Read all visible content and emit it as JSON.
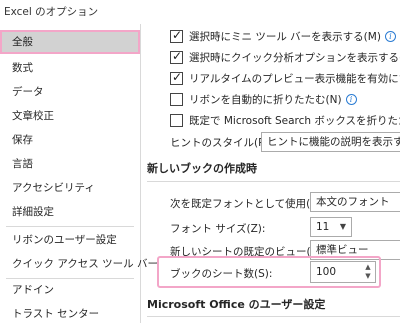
{
  "window": {
    "title": "Excel のオプション"
  },
  "sidebar": {
    "items": [
      {
        "label": "全般"
      },
      {
        "label": "数式"
      },
      {
        "label": "データ"
      },
      {
        "label": "文章校正"
      },
      {
        "label": "保存"
      },
      {
        "label": "言語"
      },
      {
        "label": "アクセシビリティ"
      },
      {
        "label": "詳細設定"
      },
      {
        "label": "リボンのユーザー設定"
      },
      {
        "label": "クイック アクセス ツール バー"
      },
      {
        "label": "アドイン"
      },
      {
        "label": "トラスト センター"
      }
    ],
    "selected": "全般"
  },
  "ui_options": {
    "mini_toolbar": {
      "label": "選択時にミニ ツール バーを表示する(M)",
      "checked": true
    },
    "quick_analysis": {
      "label": "選択時にクイック分析オプションを表示する(Q)",
      "checked": true
    },
    "live_preview": {
      "label": "リアルタイムのプレビュー表示機能を有効にする(L)",
      "checked": true
    },
    "collapse_ribbon": {
      "label": "リボンを自動的に折りたたむ(N)",
      "checked": false
    },
    "collapse_search": {
      "label": "既定で Microsoft Search ボックスを折りたたむ(B)",
      "checked": false
    },
    "tooltip_style": {
      "label": "ヒントのスタイル(R):",
      "value": "ヒントに機能の説明を表示する"
    }
  },
  "new_workbook": {
    "section_title": "新しいブックの作成時",
    "default_font": {
      "label": "次を既定フォントとして使用(N):",
      "value": "本文のフォント"
    },
    "font_size": {
      "label": "フォント サイズ(Z):",
      "value": "11"
    },
    "default_view": {
      "label": "新しいシートの既定のビュー(V):",
      "value": "標準ビュー"
    },
    "sheet_count": {
      "label": "ブックのシート数(S):",
      "value": "100"
    }
  },
  "user_settings": {
    "section_title": "Microsoft Office のユーザー設定"
  },
  "colors": {
    "highlight": "#f3a6c8",
    "selected_bg": "#d2d2d2",
    "info": "#2b7cd3"
  }
}
